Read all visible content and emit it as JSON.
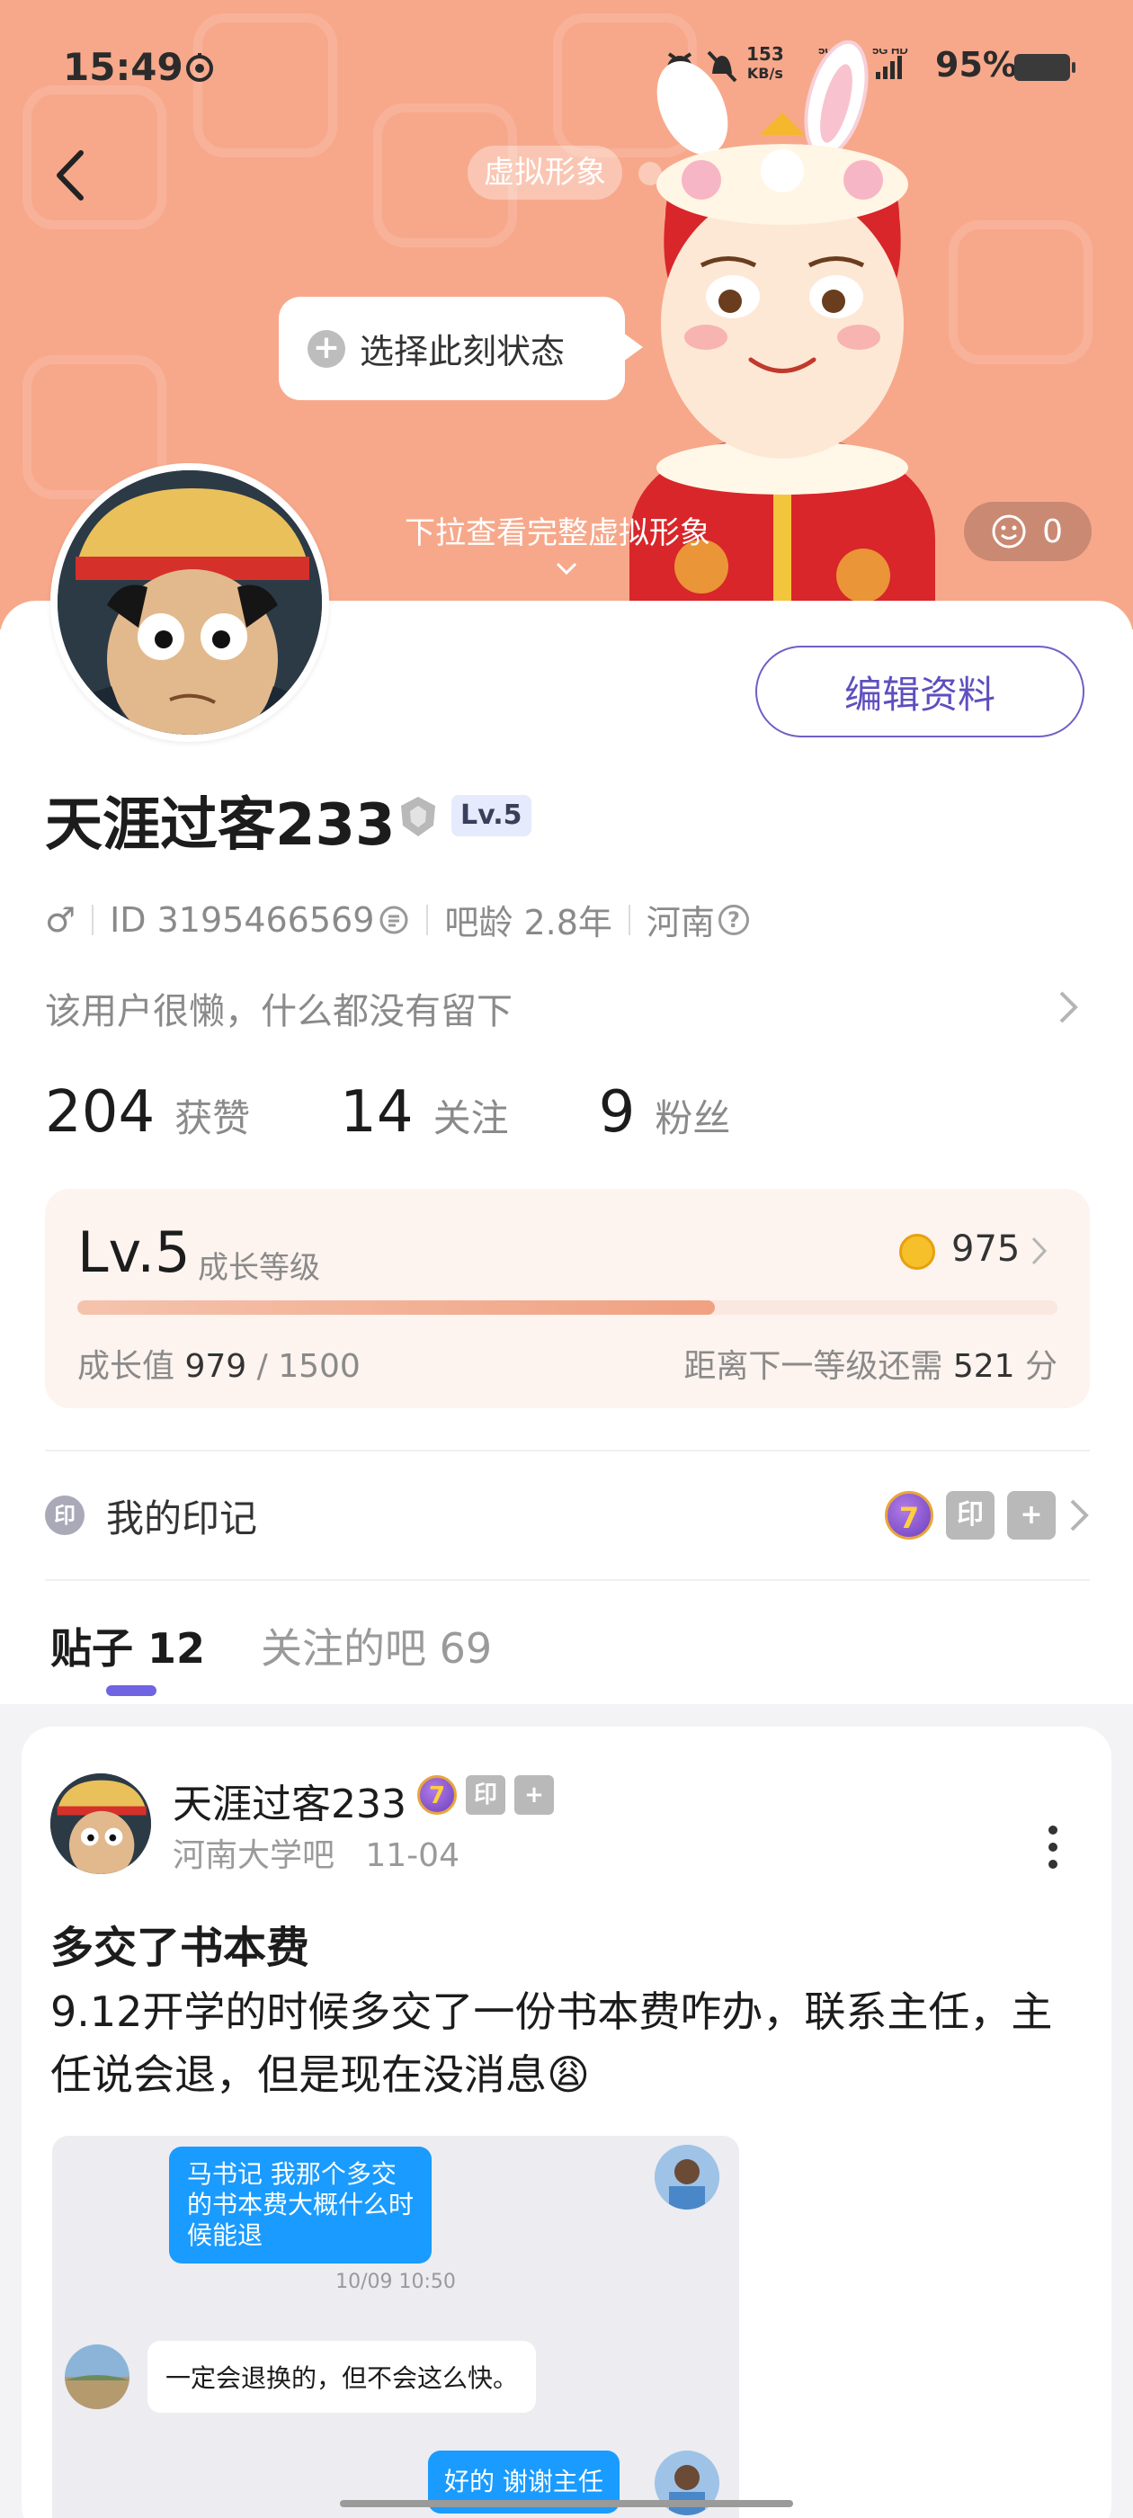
{
  "status_bar": {
    "time": "15:49",
    "net_speed": "153",
    "net_unit": "KB/s",
    "battery": "95%"
  },
  "header": {
    "avatar_pill": "虚拟形象",
    "status_bubble": "选择此刻状态",
    "pull_hint": "下拉查看完整虚拟形象",
    "like_count": "0"
  },
  "profile": {
    "edit_button": "编辑资料",
    "username": "天涯过客233",
    "level_tag": "Lv.5",
    "gender": "♂",
    "id": "ID 3195466569",
    "bar_age": "吧龄 2.8年",
    "location": "河南",
    "bio": "该用户很懒，什么都没有留下",
    "stats": [
      {
        "num": "204",
        "label": "获赞"
      },
      {
        "num": "14",
        "label": "关注"
      },
      {
        "num": "9",
        "label": "粉丝"
      }
    ]
  },
  "growth": {
    "level": "Lv.5",
    "level_label": "成长等级",
    "coins": "975",
    "progress_label": "成长值",
    "current": "979",
    "total": "/ 1500",
    "need_prefix": "距离下一等级还需",
    "need_value": "521",
    "need_suffix": "分",
    "progress_fraction": 0.65
  },
  "marks": {
    "icon_char": "印",
    "label": "我的印记",
    "badge_seven": "7",
    "badge_yin": "印",
    "badge_plus": "+"
  },
  "tabs": {
    "posts": "贴子 12",
    "bars": "关注的吧 69"
  },
  "post": {
    "author": "天涯过客233",
    "bar": "河南大学吧",
    "date": "11-04",
    "title": "多交了书本费",
    "body": "9.12开学的时候多交了一份书本费咋办，联系主任，主任说会退，但是现在没消息😩",
    "chat": {
      "msg1": "马书记 我那个多交的书本费大概什么时候能退",
      "time": "10/09 10:50",
      "msg2": "一定会退换的，但不会这么快。",
      "msg3": "好的 谢谢主任"
    }
  },
  "colors": {
    "header_bg": "#f7a88b",
    "accent": "#6f5fc7",
    "coin": "#f5c02a"
  }
}
